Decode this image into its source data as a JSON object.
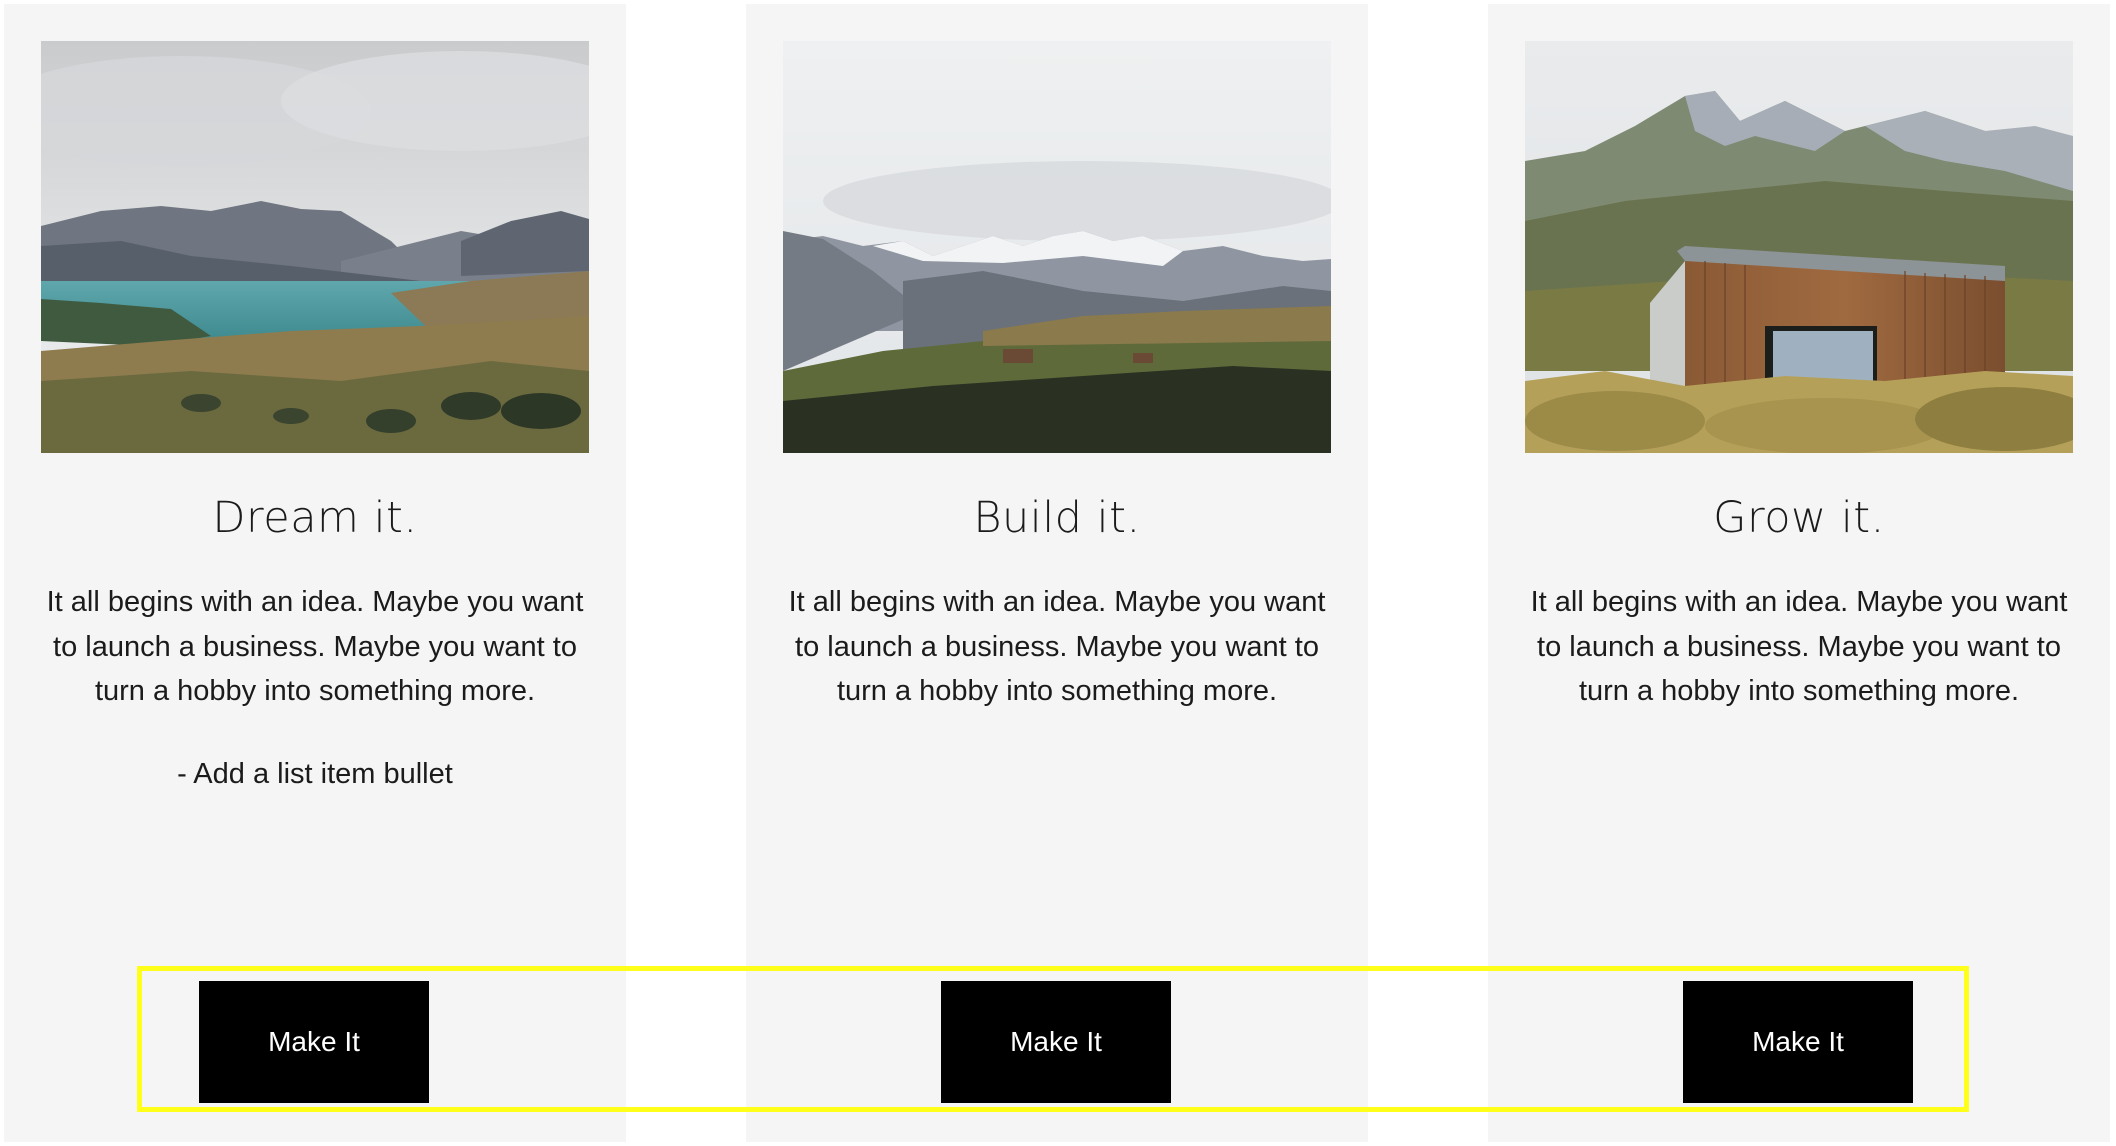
{
  "cards": [
    {
      "title": "Dream it.",
      "body": "It all begins with an idea. Maybe you want to launch a business. Maybe you want to turn a hobby into something more.",
      "bullet": "- Add a list item bullet",
      "button_label": "Make It",
      "image": "lake-mountains-landscape"
    },
    {
      "title": "Build it.",
      "body": "It all begins with an idea. Maybe you want to launch a business. Maybe you want to turn a hobby into something more.",
      "bullet": "",
      "button_label": "Make It",
      "image": "snowy-mountain-range-landscape"
    },
    {
      "title": "Grow it.",
      "body": "It all begins with an idea. Maybe you want to launch a business. Maybe you want to turn a hobby into something more.",
      "bullet": "",
      "button_label": "Make It",
      "image": "wooden-cabin-mountain"
    }
  ],
  "colors": {
    "card_background": "#f5f5f5",
    "button_background": "#000000",
    "button_text": "#ffffff",
    "highlight_border": "#ffff1a"
  }
}
